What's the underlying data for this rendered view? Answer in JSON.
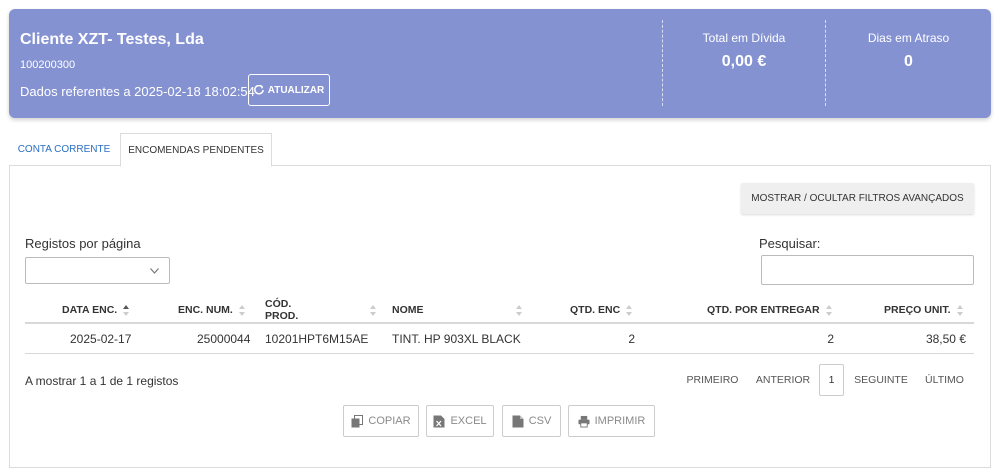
{
  "header": {
    "client_name": "Cliente XZT- Testes, Lda",
    "client_code": "100200300",
    "data_ref": "Dados referentes a 2025-02-18 18:02:54",
    "refresh_label": "ATUALIZAR",
    "kpis": [
      {
        "label": "Total em Dívida",
        "value": "0,00 €"
      },
      {
        "label": "Dias em Atraso",
        "value": "0"
      }
    ],
    "bg_color": "#8592d2"
  },
  "tabs": [
    {
      "label": "CONTA CORRENTE",
      "active": false
    },
    {
      "label": "ENCOMENDAS PENDENTES",
      "active": true
    }
  ],
  "filters_button_label": "MOSTRAR / OCULTAR FILTROS AVANÇADOS",
  "records_per_page": {
    "label": "Registos por página",
    "value": ""
  },
  "search": {
    "label": "Pesquisar:",
    "value": ""
  },
  "table": {
    "columns": [
      "DATA ENC.",
      "ENC. NUM.",
      "CÓD. PROD.",
      "NOME",
      "QTD. ENC",
      "QTD. POR ENTREGAR",
      "PREÇO UNIT."
    ],
    "sorted_column": "DATA ENC.",
    "rows": [
      [
        "2025-02-17",
        "25000044",
        "10201HPT6M15AE",
        "TINT. HP 903XL BLACK",
        "2",
        "2",
        "38,50 €"
      ]
    ]
  },
  "info_text": "A mostrar 1 a 1 de 1 registos",
  "pagination": {
    "first": "PRIMEIRO",
    "previous": "ANTERIOR",
    "current_page": "1",
    "next": "SEGUINTE",
    "last": "ÚLTIMO"
  },
  "export_buttons": [
    {
      "label": "COPIAR",
      "icon": "copy-icon"
    },
    {
      "label": "EXCEL",
      "icon": "excel-file-icon"
    },
    {
      "label": "CSV",
      "icon": "csv-file-icon"
    },
    {
      "label": "IMPRIMIR",
      "icon": "print-icon"
    }
  ]
}
